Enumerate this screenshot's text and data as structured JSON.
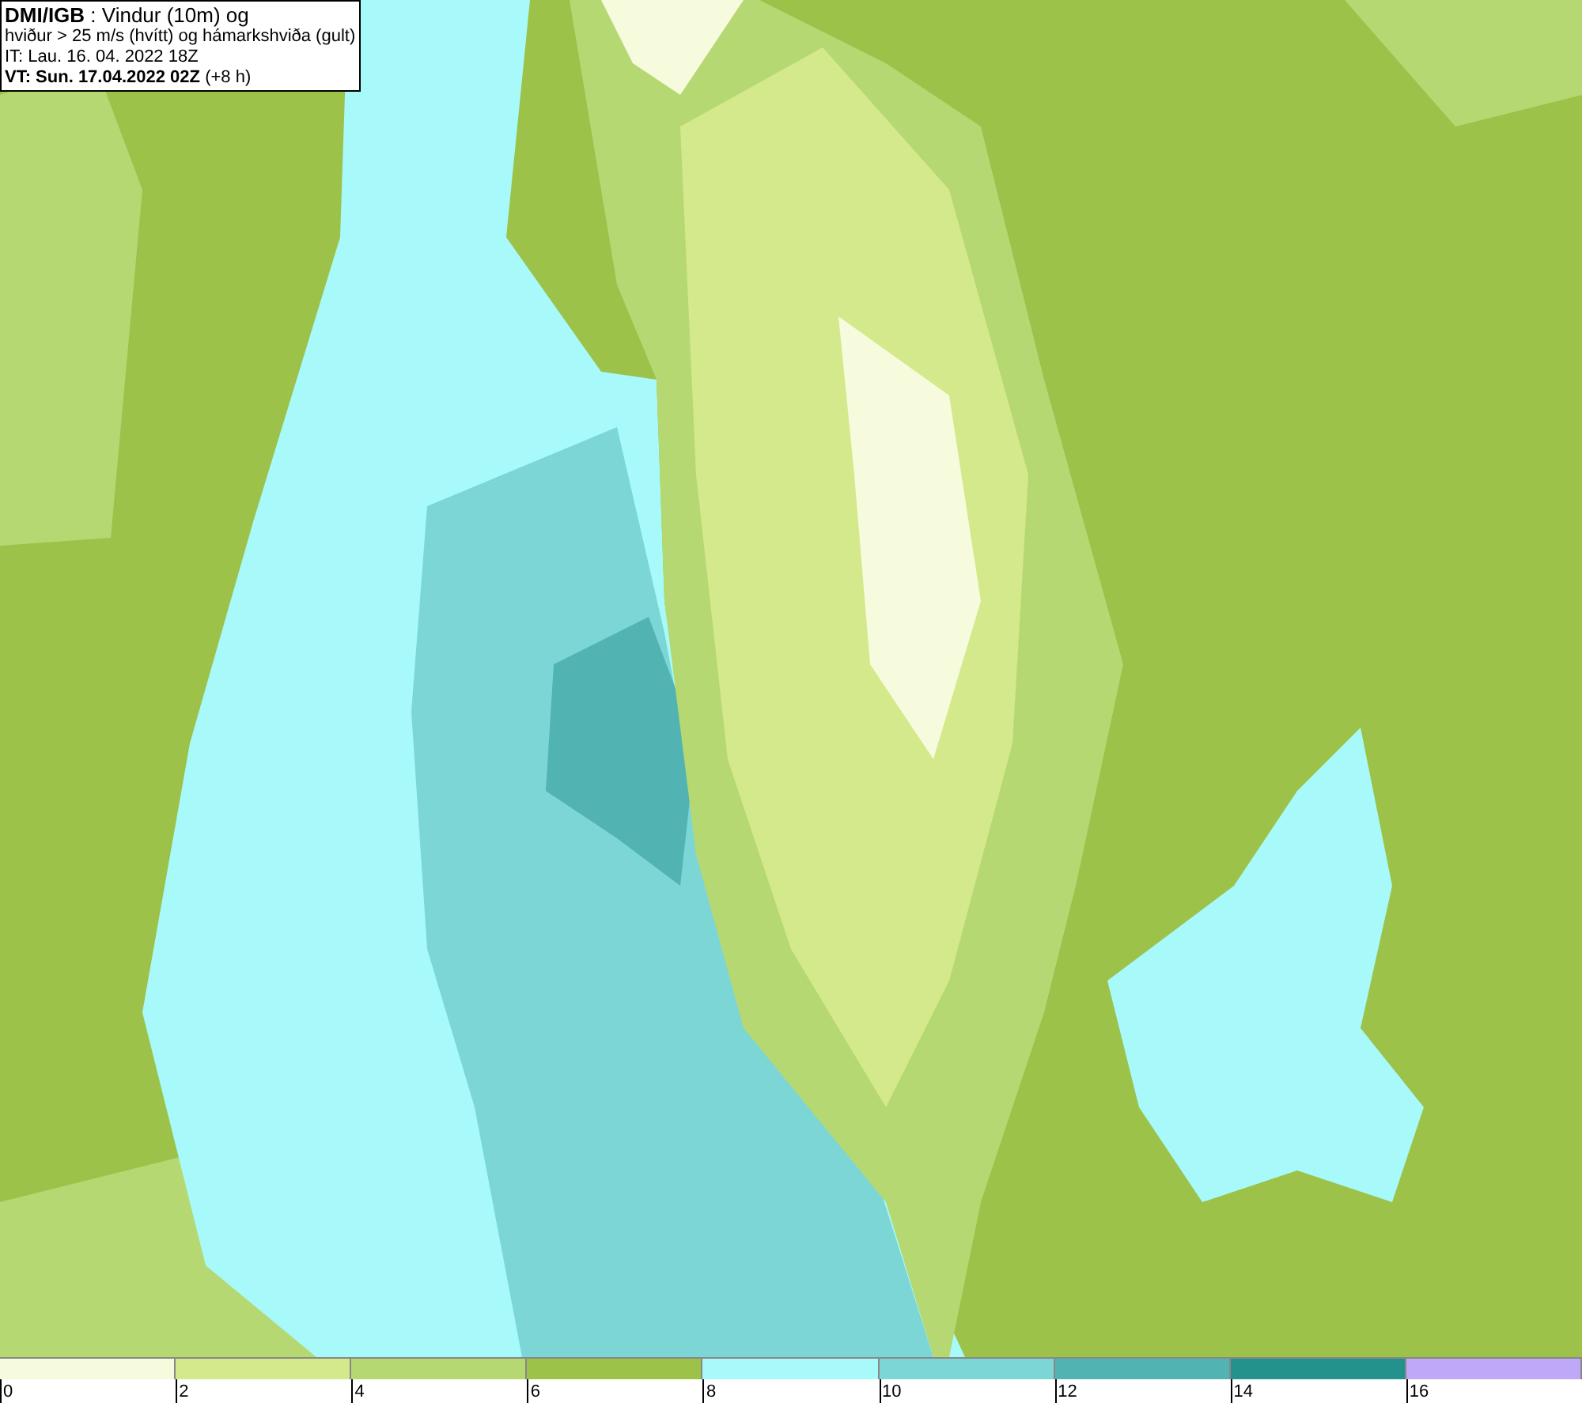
{
  "title_box": {
    "lines": [
      "**DMI/IGB** : Vindur (10m) og",
      "hviður > 25 m/s (hvítt) og hámarkshviða (gult)",
      "IT: Lau. 16. 04. 2022 18Z",
      "**VT: Sun. 17.04.2022 02Z** (+8 h)"
    ]
  },
  "legend": [
    {
      "label": "0",
      "color": "#f5fbdc"
    },
    {
      "label": "2",
      "color": "#d4e98c"
    },
    {
      "label": "4",
      "color": "#b6d872"
    },
    {
      "label": "6",
      "color": "#9cc24a"
    },
    {
      "label": "8",
      "color": "#a8fafa"
    },
    {
      "label": "10",
      "color": "#7dd6d6"
    },
    {
      "label": "12",
      "color": "#52b4b2"
    },
    {
      "label": "14",
      "color": "#23918c"
    },
    {
      "label": "16",
      "color": "#c0a8f8"
    }
  ]
}
